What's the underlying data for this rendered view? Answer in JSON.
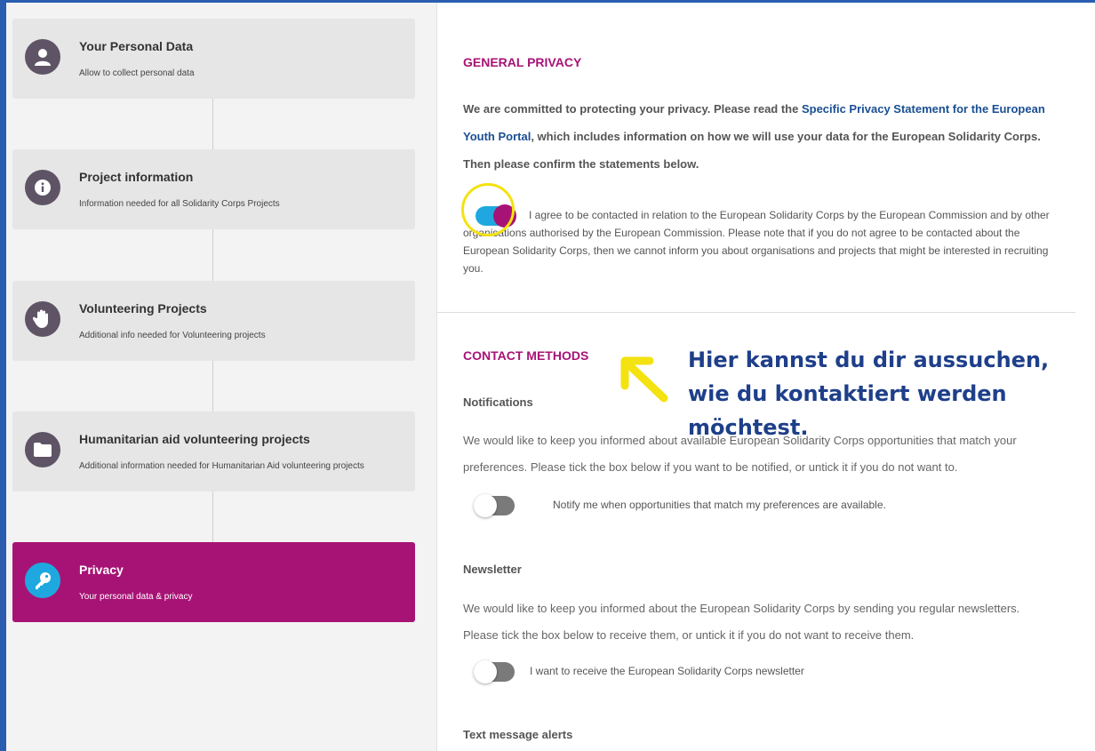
{
  "sidebar": {
    "steps": [
      {
        "title": "Your Personal Data",
        "desc": "Allow to collect personal data",
        "icon": "user-icon"
      },
      {
        "title": "Project information",
        "desc": "Information needed for all Solidarity Corps Projects",
        "icon": "info-icon"
      },
      {
        "title": "Volunteering Projects",
        "desc": "Additional info needed for Volunteering projects",
        "icon": "hand-icon"
      },
      {
        "title": "Humanitarian aid volunteering projects",
        "desc": "Additional information needed for Humanitarian Aid volunteering projects",
        "icon": "folder-icon"
      },
      {
        "title": "Privacy",
        "desc": "Your personal data & privacy",
        "icon": "key-icon",
        "active": true
      }
    ]
  },
  "general_privacy": {
    "heading": "GENERAL PRIVACY",
    "intro_before": "We are committed to protecting your privacy. Please read the ",
    "intro_link": "Specific Privacy Statement for the European Youth Portal",
    "intro_after": ", which includes information on how we will use your data for the European Solidarity Corps. Then please confirm the statements below.",
    "consent_text": "I agree to be contacted in relation to the European Solidarity Corps by the European Commission and by other organisations authorised by the European Commission. Please note that if you do not agree to be contacted about the European Solidarity Corps, then we cannot inform you about organisations and projects that might be interested in recruiting you.",
    "consent_on": true
  },
  "contact_methods": {
    "heading": "CONTACT METHODS",
    "notifications": {
      "title": "Notifications",
      "text": "We would like to keep you informed about available European Solidarity Corps opportunities that match your preferences. Please tick the box below if you want to be notified, or untick it if you do not want to.",
      "toggle_label": "Notify me when opportunities that match my preferences are available.",
      "on": false
    },
    "newsletter": {
      "title": "Newsletter",
      "text": "We would like to keep you informed about the European Solidarity Corps by sending you regular newsletters. Please tick the box below to receive them, or untick it if you do not want to receive them.",
      "toggle_label": "I want to receive the European Solidarity Corps newsletter",
      "on": false
    },
    "sms": {
      "title": "Text message alerts"
    }
  },
  "annotation": {
    "text": "Hier kannst du dir aussuchen, wie du kontaktiert werden möchtest.",
    "color": "#1e3f8a",
    "highlight_color": "#f4e211"
  },
  "colors": {
    "accent": "#a71375",
    "toggle_on": "#1fa8e0",
    "link": "#1a4f93",
    "frame": "#2a5db0"
  }
}
